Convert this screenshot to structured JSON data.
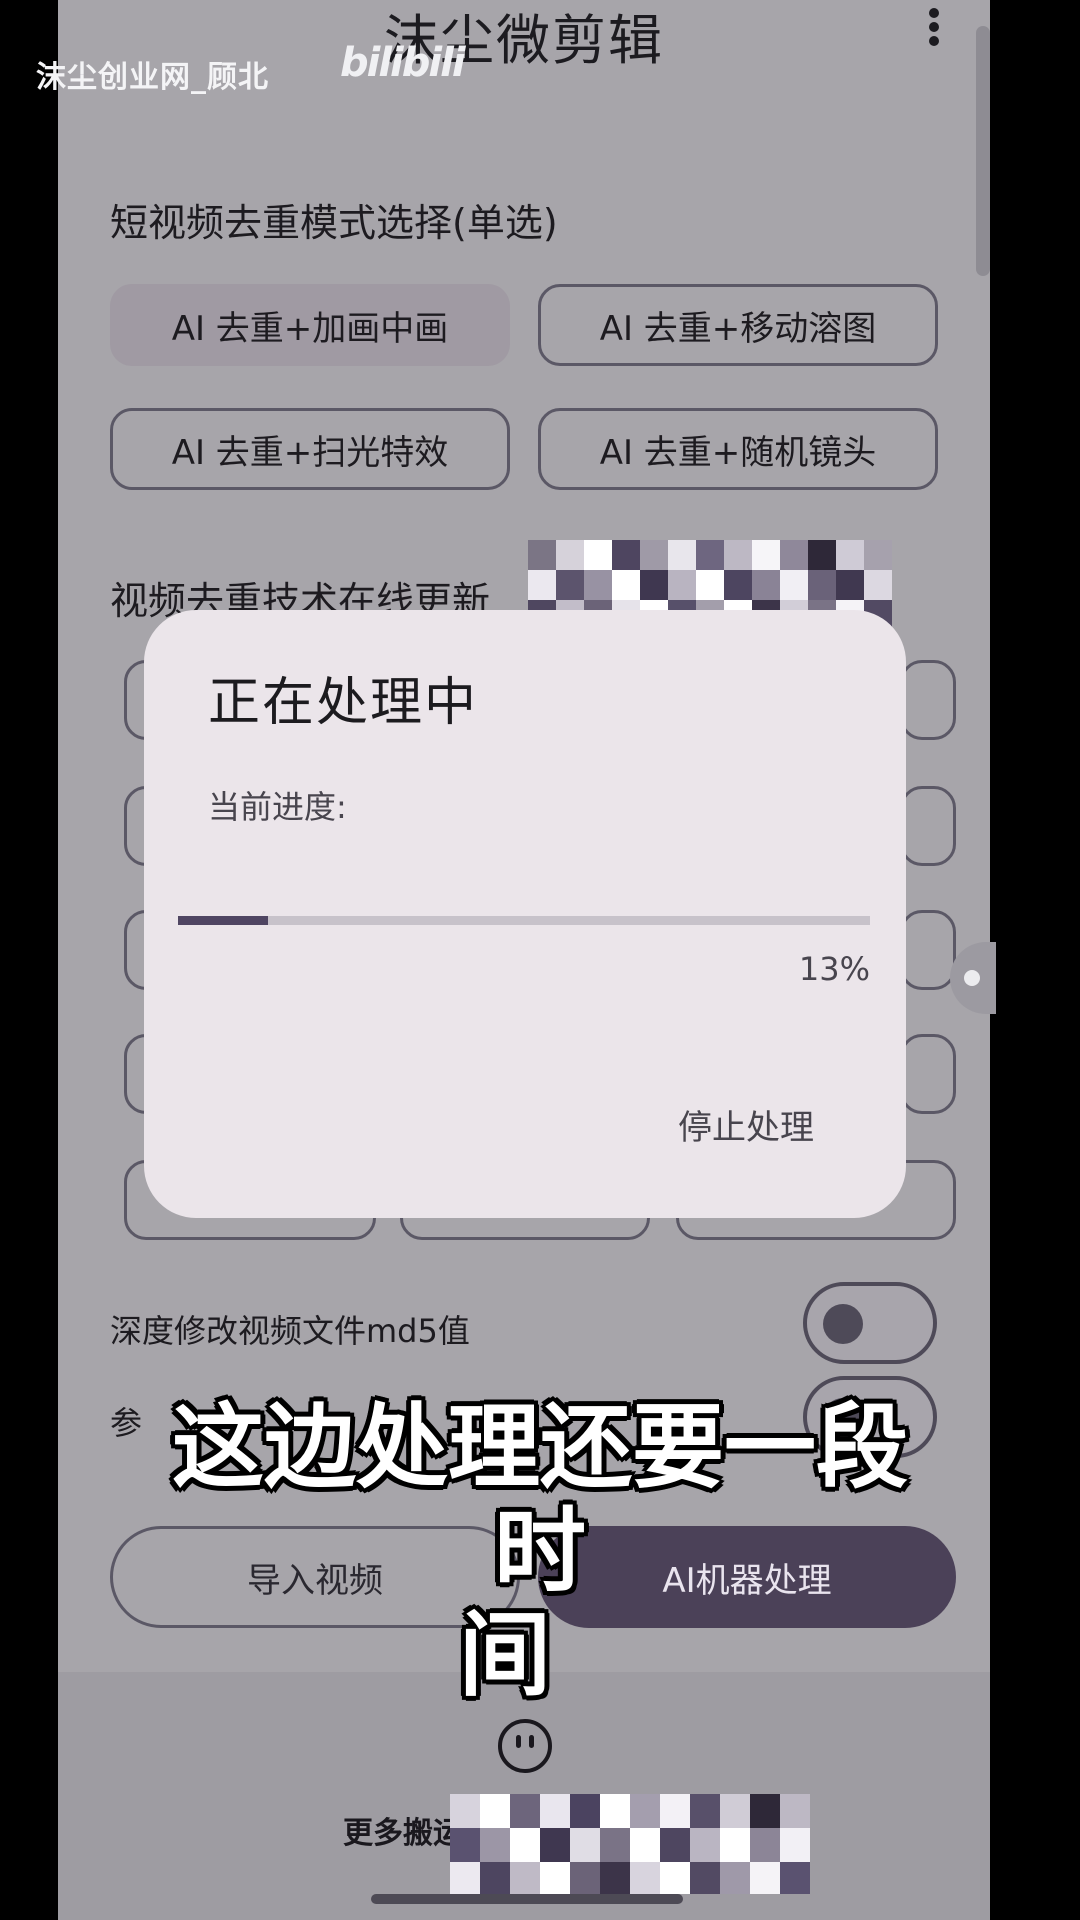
{
  "app": {
    "title": "沫尘微剪辑"
  },
  "watermark": {
    "text": "沫尘创业网_顾北",
    "logo": "bilibili"
  },
  "mode_section": {
    "title": "短视频去重模式选择(单选)",
    "options": [
      {
        "label": "AI 去重+加画中画",
        "selected": true
      },
      {
        "label": "AI 去重+移动溶图",
        "selected": false
      },
      {
        "label": "AI 去重+扫光特效",
        "selected": false
      },
      {
        "label": "AI 去重+随机镜头",
        "selected": false
      }
    ]
  },
  "update_section": {
    "title": "视频去重技术在线更新"
  },
  "md5_toggle": {
    "label": "深度修改视频文件md5值",
    "on": false
  },
  "param_row": {
    "label": "参"
  },
  "actions": {
    "import": "导入视频",
    "ai_process": "AI机器处理"
  },
  "footer": {
    "more_text": "更多搬运"
  },
  "dialog": {
    "title": "正在处理中",
    "progress_label": "当前进度:",
    "progress": 0.13,
    "progress_text": "13%",
    "stop_label": "停止处理"
  },
  "subtitle": {
    "line1": "这边处理还要一段时",
    "line2": "间"
  },
  "colors": {
    "accent": "#4b4158",
    "dialog_bg": "#ebe5ea",
    "screen_bg": "#a7a5aa"
  }
}
